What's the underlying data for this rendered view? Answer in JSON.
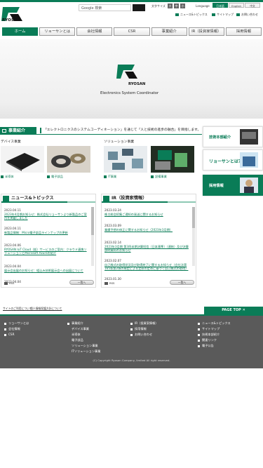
{
  "brand": {
    "name": "RYOSAN",
    "tagline": "Electronics System Coordinator"
  },
  "header": {
    "search_placeholder": "Google 検索",
    "font_size_label": "文字サイズ",
    "font_sizes": [
      "大",
      "中",
      "小"
    ],
    "language_label": "Language",
    "languages": [
      "日本語",
      "English",
      "中文"
    ],
    "util_links": [
      "ニュース&トピックス",
      "サイトマップ",
      "お問い合わせ"
    ]
  },
  "nav": [
    "ホーム",
    "リョーサンとは",
    "会社情報",
    "CSR",
    "事業紹介",
    "IR（投資家情報）",
    "採用情報"
  ],
  "business": {
    "heading": "事業紹介",
    "message": "「エレクトロニクスのシステムコーディネーション」を通じて「人と技術の進歩の融合」を目指します。",
    "device_heading": "デバイス事業",
    "solution_heading": "ソリューション事業",
    "captions": [
      "半導体",
      "電子部品",
      "IT事業",
      "設備事業"
    ]
  },
  "side_boxes": [
    "技術本部紹介",
    "リョーサンとは？",
    "採用情報"
  ],
  "news": {
    "heading": "ニュース&トピックス",
    "items": [
      {
        "date": "2023.04.11",
        "title": "2023年4月期お知らせ：株式会社リョーサンより新製品のご案内を掲載しました"
      },
      {
        "date": "2023.04.11",
        "title": "新製品情報：Micro電子部品ラインナップの更新"
      },
      {
        "date": "2023.04.06",
        "title": "RYOSAN IoT Cloud（仮）サービスのご案内：クラウド連携ソリューションとMicrosoft Azureの紹介"
      },
      {
        "date": "2023.04.04",
        "title": "展示会出展のお知らせ：組込み技術展示会への出展について"
      },
      {
        "date": "2023.04.04",
        "title": ""
      }
    ],
    "rss": "RSS",
    "more": "一覧へ"
  },
  "ir": {
    "heading": "IR（投資家情報）",
    "items": [
      {
        "date": "2023.03.24",
        "title": "株主総会招集ご通知の発送に関するお知らせ"
      },
      {
        "date": "2023.03.09",
        "title": "業績予想の修正に関するお知らせ（2023年3月期）"
      },
      {
        "date": "2023.02.14",
        "title": "2023年3月期 第3四半期決算短信〔日本基準〕（連結）及び決算説明資料のお知らせ"
      },
      {
        "date": "2023.02.07",
        "title": "自己株式の取得状況及び取得終了に関するお知らせ（会社法第165条第2項の規定による定款の定めに基づく自己株式の取得）"
      },
      {
        "date": "2023.01.30",
        "title": ""
      }
    ],
    "rss": "RSS",
    "more": "一覧へ"
  },
  "breadcrumbs": [
    "サイトのご利用について",
    "個人情報保護方針について"
  ],
  "pagetop": "PAGE TOP",
  "footer": {
    "col1": [
      "リョーサンとは",
      "会社情報",
      "CSR"
    ],
    "col2": [
      "事業紹介",
      "デバイス事業",
      "半導体",
      "電子部品",
      "ソリューション事業",
      "ITソリューション事業"
    ],
    "col3": [
      "IR（投資家情報）",
      "採用情報",
      "お問い合わせ"
    ],
    "col4": [
      "ニュース&トピックス",
      "サイトマップ",
      "技術本部紹介",
      "関連リンク",
      "電子公告"
    ],
    "copyright": "(C) Copyright Ryosan Company, limited All right reserved."
  },
  "colors": {
    "accent": "#0a7c57",
    "footer_bg": "#5a5a5a"
  }
}
